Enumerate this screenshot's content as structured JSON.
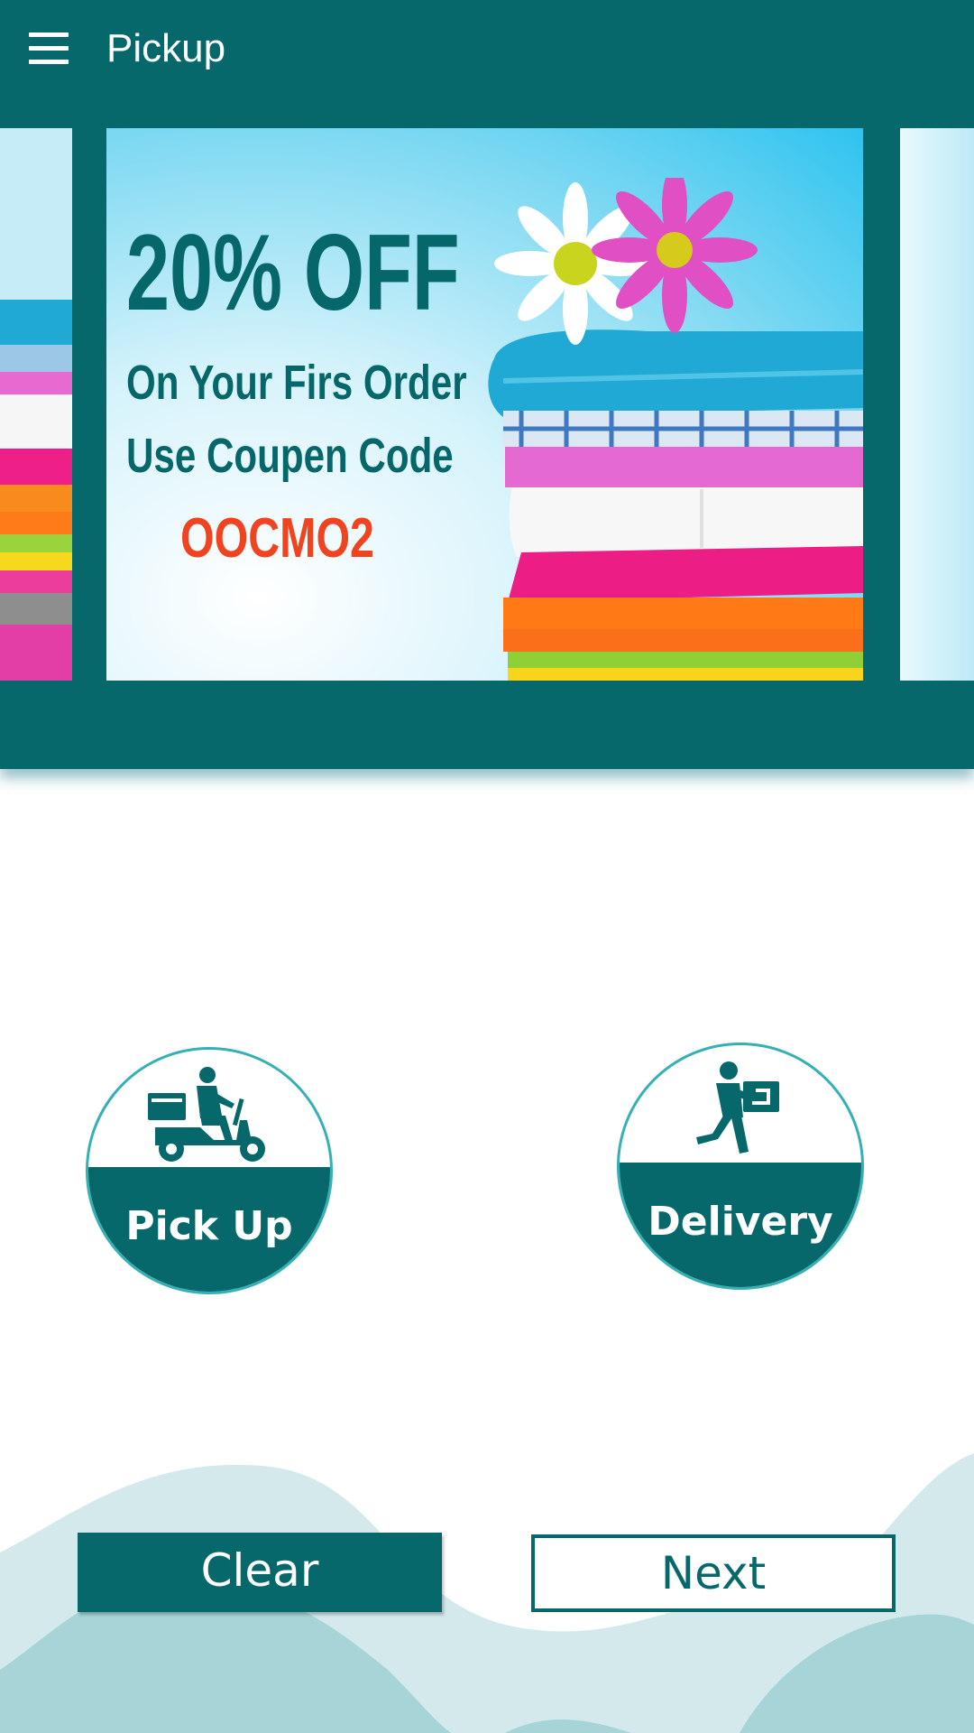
{
  "app": {
    "title": "Pickup"
  },
  "banner": {
    "headline": "20% OFF",
    "line1": "On Your Firs Order",
    "line2": "Use Coupen Code",
    "code": "OOCMO2"
  },
  "options": {
    "pickup": {
      "label": "Pick Up",
      "icon": "scooter-rider-icon"
    },
    "delivery": {
      "label": "Delivery",
      "icon": "running-courier-box-icon"
    }
  },
  "buttons": {
    "clear": "Clear",
    "next": "Next"
  },
  "colors": {
    "primary": "#07686c",
    "accent_code": "#f0431f",
    "wave_light": "#d3e9ec",
    "wave_mid": "#a6d4d7"
  }
}
